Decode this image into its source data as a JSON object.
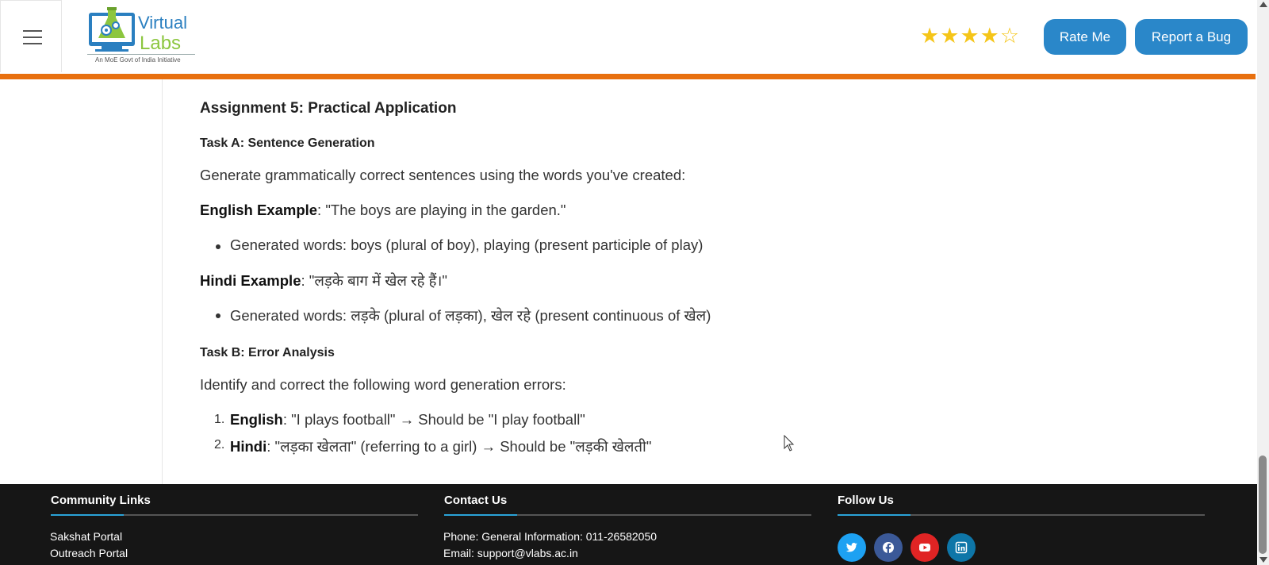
{
  "header": {
    "logo": {
      "title_part1": "Virtual",
      "title_part2": "Labs",
      "subtitle": "An MoE Govt of India Initiative"
    },
    "rating": {
      "filled": 4,
      "total": 5,
      "star_color": "#f5c518"
    },
    "rate_button": "Rate Me",
    "bug_button": "Report a Bug",
    "accent_color": "#e8700f",
    "button_color": "#2a87c9"
  },
  "content": {
    "assignment_title": "Assignment 5: Practical Application",
    "task_a": {
      "title": "Task A: Sentence Generation",
      "intro": "Generate grammatically correct sentences using the words you've created:",
      "english_label": "English Example",
      "english_text": ": \"The boys are playing in the garden.\"",
      "english_bullet": "Generated words: boys (plural of boy), playing (present participle of play)",
      "hindi_label": "Hindi Example",
      "hindi_text": ": \"लड़के बाग में खेल रहे हैं।\"",
      "hindi_bullet": "Generated words: लड़के (plural of लड़का), खेल रहे (present continuous of खेल)"
    },
    "task_b": {
      "title": "Task B: Error Analysis",
      "intro": "Identify and correct the following word generation errors:",
      "items": [
        {
          "num": "1.",
          "label": "English",
          "text": ": \"I plays football\" → Should be \"I play football\""
        },
        {
          "num": "2.",
          "label": "Hindi",
          "text": ": \"लड़का खेलता\" (referring to a girl) → Should be \"लड़की खेलती\""
        }
      ]
    }
  },
  "footer": {
    "community": {
      "title": "Community Links",
      "links": [
        "Sakshat Portal",
        "Outreach Portal"
      ]
    },
    "contact": {
      "title": "Contact Us",
      "phone": "Phone: General Information: 011-26582050",
      "email": "Email: support@vlabs.ac.in"
    },
    "follow": {
      "title": "Follow Us",
      "icons": [
        {
          "name": "twitter-icon",
          "color": "#1da1f2"
        },
        {
          "name": "facebook-icon",
          "color": "#3b5998"
        },
        {
          "name": "youtube-icon",
          "color": "#e02424"
        },
        {
          "name": "linkedin-icon",
          "color": "#0e76a8"
        }
      ]
    }
  }
}
